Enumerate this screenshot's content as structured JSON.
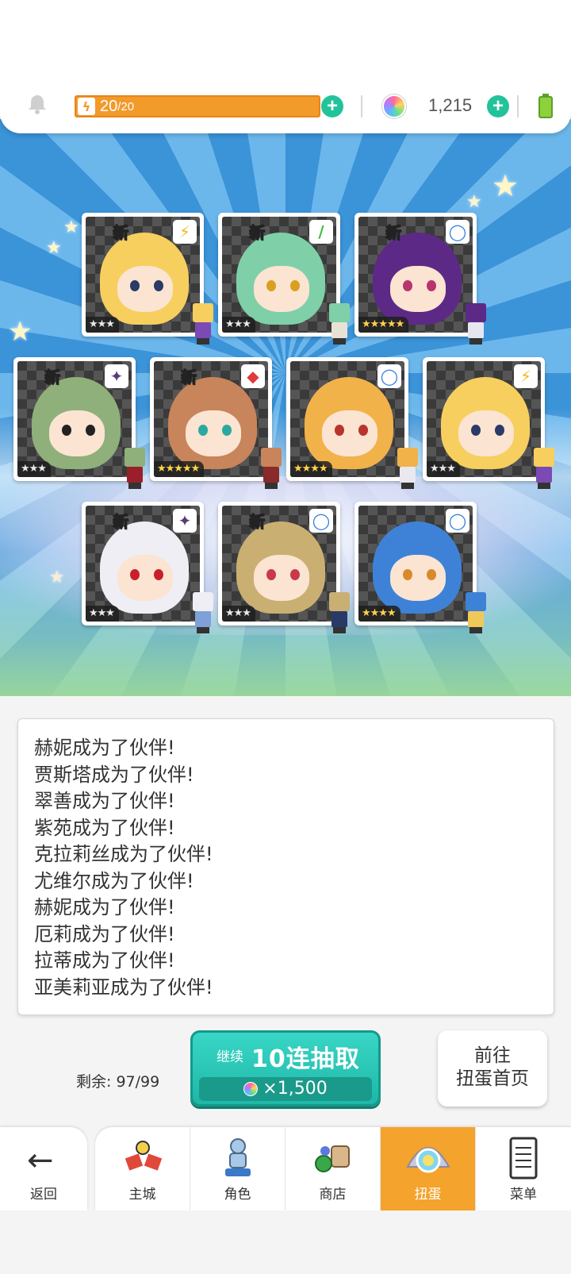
{
  "status": {
    "stamina_current": "20",
    "stamina_max": "/20",
    "stamina_fill": 1.0,
    "gem_count": "1,215",
    "icons": {
      "bell": "bell-icon",
      "stamina": "lightning-icon",
      "gem": "rainbow-gem-icon",
      "battery": "battery-icon",
      "add": "plus-icon"
    }
  },
  "cards": [
    {
      "new": "新",
      "element": "lightning",
      "element_glyph": "⚡",
      "element_color": "#f2b722",
      "stars": "★★★",
      "rarity": 3,
      "hair": "#f7cf5e",
      "eye": "#2b3a66",
      "accent": "#7b4ab5"
    },
    {
      "new": "新",
      "element": "leaf",
      "element_glyph": "/",
      "element_color": "#3fbf3a",
      "stars": "★★★",
      "rarity": 3,
      "hair": "#7fd0a8",
      "eye": "#d8a020",
      "accent": "#e8e2d4"
    },
    {
      "new": "新",
      "element": "water",
      "element_glyph": "◯",
      "element_color": "#2f7fe0",
      "stars": "★★★★★",
      "rarity": 5,
      "hair": "#5c2a86",
      "eye": "#b8346c",
      "accent": "#e6e6f0"
    },
    {
      "new": "新",
      "element": "dark",
      "element_glyph": "✦",
      "element_color": "#5a3a78",
      "stars": "★★★",
      "rarity": 3,
      "hair": "#8fb07a",
      "eye": "#222",
      "accent": "#9a1f2a"
    },
    {
      "new": "新",
      "element": "fire",
      "element_glyph": "◆",
      "element_color": "#e03a3a",
      "stars": "★★★★★",
      "rarity": 5,
      "hair": "#c8845a",
      "eye": "#2aa9a0",
      "accent": "#8a2a2a"
    },
    {
      "new": "",
      "element": "water",
      "element_glyph": "◯",
      "element_color": "#2f7fe0",
      "stars": "★★★★",
      "rarity": 4,
      "hair": "#f2b24a",
      "eye": "#b8342c",
      "accent": "#e8e8ee"
    },
    {
      "new": "",
      "element": "lightning",
      "element_glyph": "⚡",
      "element_color": "#f2b722",
      "stars": "★★★",
      "rarity": 3,
      "hair": "#f7cf5e",
      "eye": "#2b3a66",
      "accent": "#7b4ab5"
    },
    {
      "new": "新",
      "element": "dark",
      "element_glyph": "✦",
      "element_color": "#5a3a78",
      "stars": "★★★",
      "rarity": 3,
      "hair": "#eeeef4",
      "eye": "#c8202a",
      "accent": "#7fa0d8"
    },
    {
      "new": "新",
      "element": "water",
      "element_glyph": "◯",
      "element_color": "#2f7fe0",
      "stars": "★★★",
      "rarity": 3,
      "hair": "#c9b072",
      "eye": "#c83a4a",
      "accent": "#2a3a66"
    },
    {
      "new": "",
      "element": "water",
      "element_glyph": "◯",
      "element_color": "#2f7fe0",
      "stars": "★★★★",
      "rarity": 4,
      "hair": "#3e82d8",
      "eye": "#d88a2a",
      "accent": "#f0c85a"
    }
  ],
  "log_lines": [
    "赫妮成为了伙伴!",
    "贾斯塔成为了伙伴!",
    "翠善成为了伙伴!",
    "紫苑成为了伙伴!",
    "克拉莉丝成为了伙伴!",
    "尤维尔成为了伙伴!",
    "赫妮成为了伙伴!",
    "厄莉成为了伙伴!",
    "拉蒂成为了伙伴!",
    "亚美莉亚成为了伙伴!"
  ],
  "remaining": "剩余: 97/99",
  "pull_button": {
    "continue": "继续",
    "label": "10连抽取",
    "cost": "×1,500"
  },
  "goto_button": {
    "line1": "前往",
    "line2": "扭蛋首页"
  },
  "nav": {
    "back": "返回",
    "tabs": [
      {
        "label": "主城",
        "icon": "castle-icon"
      },
      {
        "label": "角色",
        "icon": "character-icon"
      },
      {
        "label": "商店",
        "icon": "shop-icon"
      },
      {
        "label": "扭蛋",
        "icon": "gacha-icon",
        "active": true
      },
      {
        "label": "菜单",
        "icon": "menu-icon"
      }
    ]
  }
}
